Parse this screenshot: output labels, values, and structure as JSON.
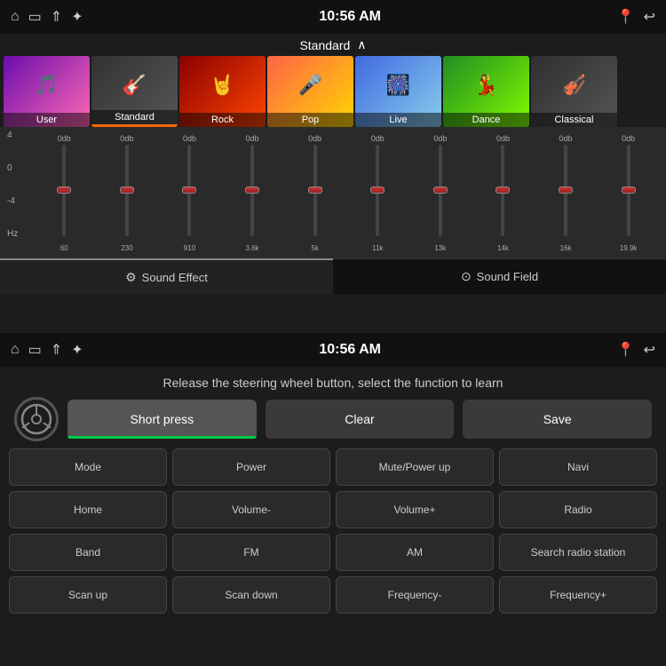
{
  "top": {
    "status": {
      "time": "10:56 AM",
      "icons_left": [
        "⌂",
        "▭",
        "⇑",
        "USB"
      ],
      "icons_right": [
        "📍",
        "↩"
      ]
    },
    "preset": {
      "label": "Standard",
      "chevron": "∧"
    },
    "genres": [
      {
        "id": "user",
        "name": "User",
        "emoji": "🎵",
        "color_class": "genre-user"
      },
      {
        "id": "standard",
        "name": "Standard",
        "emoji": "🎸",
        "color_class": "genre-standard",
        "active": true
      },
      {
        "id": "rock",
        "name": "Rock",
        "emoji": "🤘",
        "color_class": "genre-rock"
      },
      {
        "id": "pop",
        "name": "Pop",
        "emoji": "🎤",
        "color_class": "genre-pop"
      },
      {
        "id": "live",
        "name": "Live",
        "emoji": "🎆",
        "color_class": "genre-live"
      },
      {
        "id": "dance",
        "name": "Dance",
        "emoji": "💃",
        "color_class": "genre-dance"
      },
      {
        "id": "classical",
        "name": "Classical",
        "emoji": "🎻",
        "color_class": "genre-classical"
      }
    ],
    "eq": {
      "labels_left": [
        "4",
        "0",
        "-4",
        "Hz"
      ],
      "channels": [
        {
          "db": "0db",
          "freq": "60"
        },
        {
          "db": "0db",
          "freq": "230"
        },
        {
          "db": "0db",
          "freq": "910"
        },
        {
          "db": "0db",
          "freq": "3.6k"
        },
        {
          "db": "0db",
          "freq": "5k"
        },
        {
          "db": "0db",
          "freq": "11k"
        },
        {
          "db": "0db",
          "freq": "13k"
        },
        {
          "db": "0db",
          "freq": "14k"
        },
        {
          "db": "0db",
          "freq": "16k"
        },
        {
          "db": "0db",
          "freq": "19.9k"
        }
      ]
    },
    "tabs": [
      {
        "id": "sound-effect",
        "label": "Sound Effect",
        "icon": "⚙",
        "active": true
      },
      {
        "id": "sound-field",
        "label": "Sound Field",
        "icon": "⊙",
        "active": false
      }
    ]
  },
  "bottom": {
    "status": {
      "time": "10:56 AM",
      "icons_left": [
        "⌂",
        "▭",
        "⇑",
        "USB"
      ],
      "icons_right": [
        "📍",
        "↩"
      ]
    },
    "instruction": "Release the steering wheel button, select the function to learn",
    "actions": [
      {
        "id": "short-press",
        "label": "Short press",
        "style": "green-underline"
      },
      {
        "id": "clear",
        "label": "Clear",
        "style": "inactive"
      },
      {
        "id": "save",
        "label": "Save",
        "style": "inactive"
      }
    ],
    "functions": [
      {
        "id": "mode",
        "label": "Mode"
      },
      {
        "id": "power",
        "label": "Power"
      },
      {
        "id": "mute-power-up",
        "label": "Mute/Power up"
      },
      {
        "id": "navi",
        "label": "Navi"
      },
      {
        "id": "home",
        "label": "Home"
      },
      {
        "id": "volume-minus",
        "label": "Volume-"
      },
      {
        "id": "volume-plus",
        "label": "Volume+"
      },
      {
        "id": "radio",
        "label": "Radio"
      },
      {
        "id": "band",
        "label": "Band"
      },
      {
        "id": "fm",
        "label": "FM"
      },
      {
        "id": "am",
        "label": "AM"
      },
      {
        "id": "search-radio",
        "label": "Search radio station"
      },
      {
        "id": "scan-up",
        "label": "Scan up"
      },
      {
        "id": "scan-down",
        "label": "Scan down"
      },
      {
        "id": "frequency-minus",
        "label": "Frequency-"
      },
      {
        "id": "frequency-plus",
        "label": "Frequency+"
      }
    ]
  }
}
